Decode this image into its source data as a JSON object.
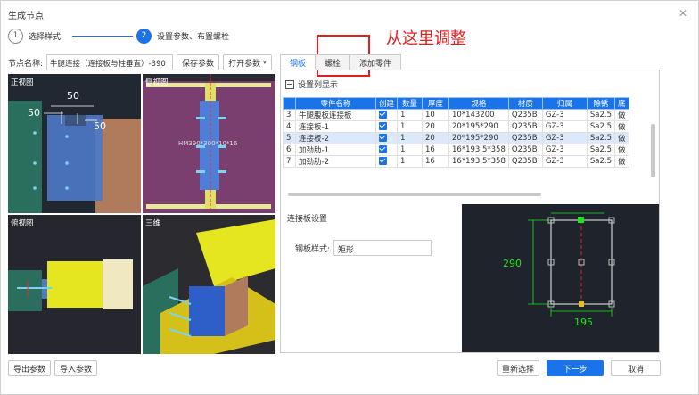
{
  "dialog": {
    "title": "生成节点"
  },
  "steps": [
    {
      "num": "1",
      "label": "选择样式"
    },
    {
      "num": "2",
      "label": "设置参数、布置螺栓"
    }
  ],
  "annotation": "从这里调整",
  "node": {
    "name_label": "节点名称:",
    "name_value": "牛腿连接（连接板与柱垂直）-390",
    "save_label": "保存参数",
    "open_label": "打开参数"
  },
  "views": {
    "front": {
      "label": "正视图",
      "dims": [
        "50",
        "50",
        "50"
      ]
    },
    "side": {
      "label": "侧视图",
      "section": "HM390*300*10*16"
    },
    "top": {
      "label": "俯视图"
    },
    "three_d": {
      "label": "三维"
    }
  },
  "tabs": [
    "钢板",
    "螺栓",
    "添加零件"
  ],
  "column_setting": "设置列显示",
  "table": {
    "headers": [
      "",
      "零件名称",
      "创建",
      "数量",
      "厚度",
      "规格",
      "材质",
      "归属",
      "除锈",
      "底"
    ],
    "rows": [
      {
        "idx": "3",
        "name": "牛腿腹板连接板",
        "qty": "1",
        "thk": "10",
        "spec": "10*143200",
        "mat": "Q235B",
        "grp": "GZ-3",
        "rust": "Sa2.5",
        "base": "做"
      },
      {
        "idx": "4",
        "name": "连接板-1",
        "qty": "1",
        "thk": "20",
        "spec": "20*195*290",
        "mat": "Q235B",
        "grp": "GZ-3",
        "rust": "Sa2.5",
        "base": "做"
      },
      {
        "idx": "5",
        "name": "连接板-2",
        "qty": "1",
        "thk": "20",
        "spec": "20*195*290",
        "mat": "Q235B",
        "grp": "GZ-3",
        "rust": "Sa2.5",
        "base": "做"
      },
      {
        "idx": "6",
        "name": "加劲肋-1",
        "qty": "1",
        "thk": "16",
        "spec": "16*193.5*358",
        "mat": "Q235B",
        "grp": "GZ-3",
        "rust": "Sa2.5",
        "base": "做"
      },
      {
        "idx": "7",
        "name": "加劲肋-2",
        "qty": "1",
        "thk": "16",
        "spec": "16*193.5*358",
        "mat": "Q235B",
        "grp": "GZ-3",
        "rust": "Sa2.5",
        "base": "做"
      }
    ],
    "selected_row": 2
  },
  "config": {
    "title": "连接板设置",
    "style_label": "钢板样式:",
    "style_value": "矩形"
  },
  "preview": {
    "height_dim": "290",
    "width_dim": "195"
  },
  "footer": {
    "export_label": "导出参数",
    "import_label": "导入参数",
    "reset_label": "重新选择",
    "next_label": "下一步",
    "cancel_label": "取消"
  },
  "colors": {
    "accent": "#1a73e8",
    "annotation": "#e02020",
    "dim_green": "#19e619"
  }
}
